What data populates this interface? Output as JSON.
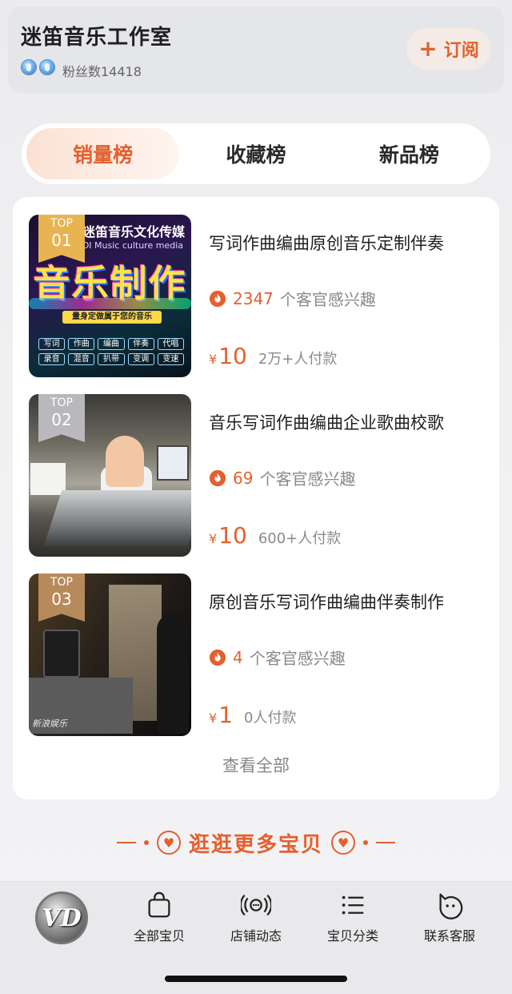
{
  "shop": {
    "name": "迷笛音乐工作室",
    "fans": "粉丝数14418",
    "follow_label": "订阅",
    "follow_icon": "plus-icon"
  },
  "tabs": [
    {
      "label": "销量榜",
      "active": true
    },
    {
      "label": "收藏榜",
      "active": false
    },
    {
      "label": "新品榜",
      "active": false
    }
  ],
  "products": [
    {
      "rank_top": "TOP",
      "rank_num": "01",
      "thumb_head": "迷笛音乐文化传媒",
      "thumb_sub": "DI Music culture media",
      "thumb_big": "音乐制作",
      "thumb_ribbon": "量身定做属于您的音乐",
      "thumb_tags": [
        "写词",
        "作曲",
        "编曲",
        "伴奏",
        "代唱",
        "录音",
        "混音",
        "扒带",
        "变调",
        "变速"
      ],
      "title": "写词作曲编曲原创音乐定制伴奏",
      "interest_count": "2347",
      "interest_label": "个客官感兴趣",
      "currency": "¥",
      "price": "10",
      "paid": "2万+人付款"
    },
    {
      "rank_top": "TOP",
      "rank_num": "02",
      "title": "音乐写词作曲编曲企业歌曲校歌",
      "interest_count": "69",
      "interest_label": "个客官感兴趣",
      "currency": "¥",
      "price": "10",
      "paid": "600+人付款"
    },
    {
      "rank_top": "TOP",
      "rank_num": "03",
      "thumb_watermark": "新浪娱乐",
      "title": "原创音乐写词作曲编曲伴奏制作",
      "interest_count": "4",
      "interest_label": "个客官感兴趣",
      "currency": "¥",
      "price": "1",
      "paid": "0人付款"
    }
  ],
  "view_all": "查看全部",
  "more": "逛逛更多宝贝",
  "bottom_nav": {
    "logo_text": "VD",
    "items": [
      {
        "label": "全部宝贝",
        "icon": "shopping-bag-icon"
      },
      {
        "label": "店铺动态",
        "icon": "broadcast-icon"
      },
      {
        "label": "宝贝分类",
        "icon": "list-icon"
      },
      {
        "label": "联系客服",
        "icon": "chat-face-icon"
      }
    ]
  },
  "colors": {
    "accent": "#e4602f",
    "gold": "#e7b451",
    "silver": "#b8b8bd",
    "bronze": "#b78a5c"
  }
}
